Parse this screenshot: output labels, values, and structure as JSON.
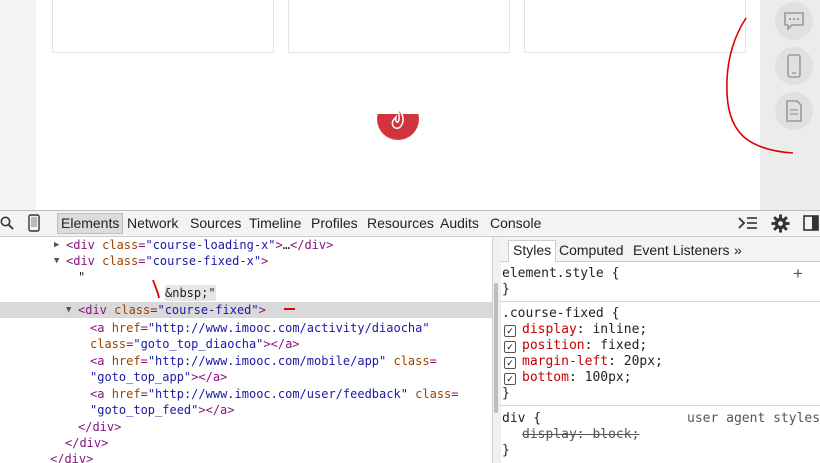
{
  "devtools": {
    "tabs": [
      "Elements",
      "Network",
      "Sources",
      "Timeline",
      "Profiles",
      "Resources",
      "Audits",
      "Console"
    ],
    "active_tab": "Elements"
  },
  "dom_lines": [
    {
      "parts": [
        [
          "tag",
          "<div "
        ],
        [
          "attr",
          "class"
        ],
        [
          "tag",
          "="
        ],
        [
          "val",
          "\"course-loading-x\""
        ],
        [
          "tag",
          ">"
        ],
        [
          "txt",
          "…"
        ],
        [
          "tag",
          "</div>"
        ]
      ]
    },
    {
      "parts": [
        [
          "tag",
          "<div "
        ],
        [
          "attr",
          "class"
        ],
        [
          "tag",
          "="
        ],
        [
          "val",
          "\"course-fixed-x\""
        ],
        [
          "tag",
          ">"
        ]
      ]
    },
    {
      "parts": [
        [
          "txt",
          "\""
        ]
      ]
    },
    {
      "parts": [
        [
          "txt",
          "&nbsp;\""
        ]
      ]
    },
    {
      "parts": [
        [
          "tag",
          "<div "
        ],
        [
          "attr",
          "class"
        ],
        [
          "tag",
          "="
        ],
        [
          "val",
          "\"course-fixed\""
        ],
        [
          "tag",
          ">"
        ]
      ]
    },
    {
      "parts": [
        [
          "tag",
          "<a "
        ],
        [
          "attr",
          "href"
        ],
        [
          "tag",
          "="
        ],
        [
          "val",
          "\"http://www.imooc.com/activity/diaocha\""
        ]
      ]
    },
    {
      "parts": [
        [
          "attr",
          "class"
        ],
        [
          "tag",
          "="
        ],
        [
          "val",
          "\"goto_top_diaocha\""
        ],
        [
          "tag",
          "></a>"
        ]
      ]
    },
    {
      "parts": [
        [
          "tag",
          "<a "
        ],
        [
          "attr",
          "href"
        ],
        [
          "tag",
          "="
        ],
        [
          "val",
          "\"http://www.imooc.com/mobile/app\""
        ],
        [
          "tag",
          " "
        ],
        [
          "attr",
          "class"
        ],
        [
          "tag",
          "="
        ]
      ]
    },
    {
      "parts": [
        [
          "val",
          "\"goto_top_app\""
        ],
        [
          "tag",
          "></a>"
        ]
      ]
    },
    {
      "parts": [
        [
          "tag",
          "<a "
        ],
        [
          "attr",
          "href"
        ],
        [
          "tag",
          "="
        ],
        [
          "val",
          "\"http://www.imooc.com/user/feedback\""
        ],
        [
          "tag",
          " "
        ],
        [
          "attr",
          "class"
        ],
        [
          "tag",
          "="
        ]
      ]
    },
    {
      "parts": [
        [
          "val",
          "\"goto_top_feed\""
        ],
        [
          "tag",
          "></a>"
        ]
      ]
    },
    {
      "parts": [
        [
          "tag",
          "</div>"
        ]
      ]
    },
    {
      "parts": [
        [
          "tag",
          "</div>"
        ]
      ]
    },
    {
      "parts": [
        [
          "tag",
          "</div>"
        ]
      ]
    }
  ],
  "styles": {
    "subtabs": [
      "Styles",
      "Computed",
      "Event Listeners",
      "»"
    ],
    "element_style": "element.style {",
    "close_brace": "}",
    "rule_selector": ".course-fixed {",
    "rule_props": [
      {
        "name": "display",
        "value": " inline;"
      },
      {
        "name": "position",
        "value": " fixed;"
      },
      {
        "name": "margin-left",
        "value": " 20px;"
      },
      {
        "name": "bottom",
        "value": " 100px;"
      }
    ],
    "ua_selector": "div {",
    "ua_label": "user agent stylesh",
    "ua_prop": "display: block;",
    "plus": "+",
    "colon": ":"
  },
  "colors": {
    "accent_red": "#d2343d",
    "annotation_red": "#e00000"
  },
  "icons": [
    "chat-icon",
    "phone-icon",
    "feedback-icon",
    "search-icon",
    "device-icon",
    "console-drawer-icon",
    "gear-icon",
    "dock-icon"
  ]
}
